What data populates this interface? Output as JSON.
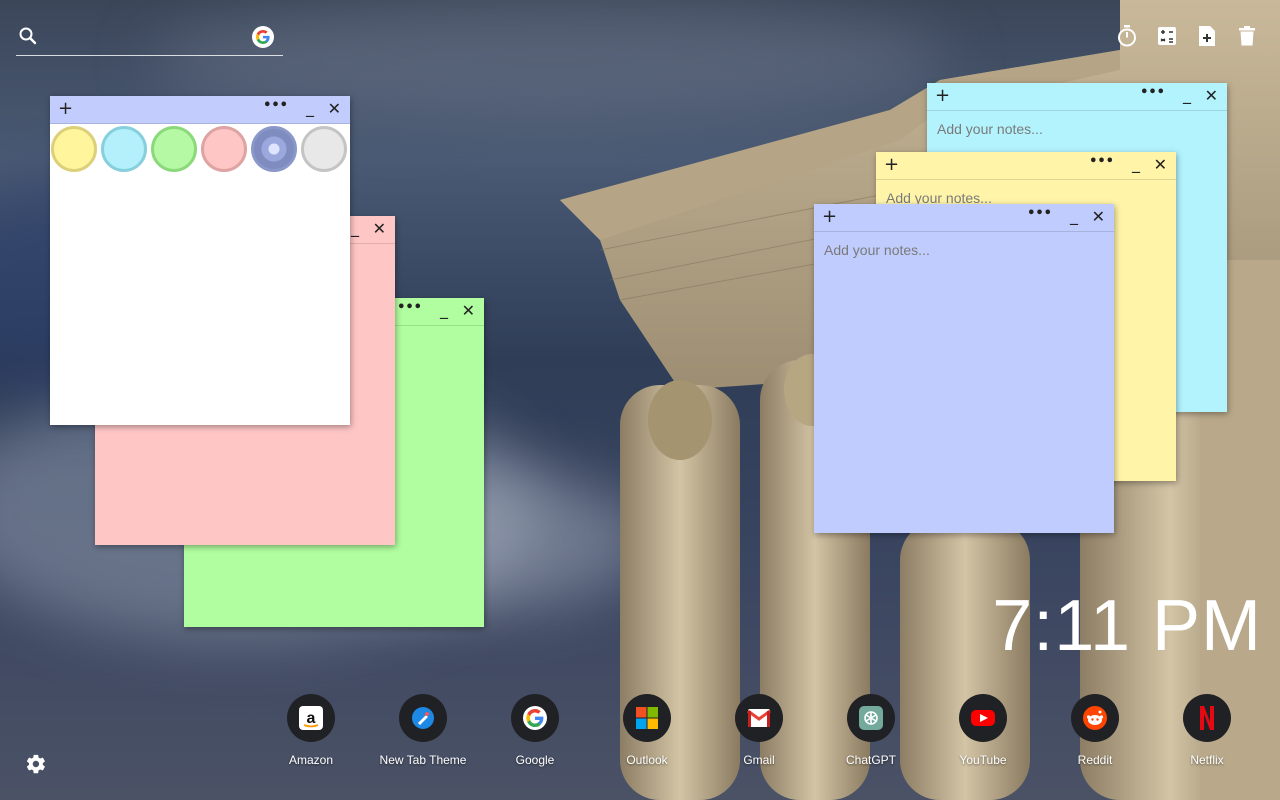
{
  "search": {
    "placeholder": "",
    "value": "",
    "icon": "search-icon",
    "engine_icon": "google-icon"
  },
  "tools": [
    {
      "name": "timer-icon"
    },
    {
      "name": "calculator-icon"
    },
    {
      "name": "add-note-icon"
    },
    {
      "name": "trash-icon"
    }
  ],
  "notes": {
    "controls": {
      "add": "+",
      "more": "•••",
      "minimize": "_",
      "close": "✕"
    },
    "placeholder": "Add your notes...",
    "colors": {
      "white": "#ffffff",
      "pink": "#ffc6c6",
      "green": "#b1fea0",
      "cyan": "#b3f3fd",
      "yellow": "#fff4a8",
      "lavender": "#bfccfd",
      "bar_white": "#c2ccfd",
      "bar_pink": "#ffc6c6",
      "bar_green": "#b1fea0",
      "bar_cyan": "#b3f3fd",
      "bar_yellow": "#fff4a8",
      "bar_lavender": "#bfccfd"
    },
    "swatches": [
      {
        "name": "yellow",
        "fill": "#fff59d",
        "ring": "#dcd07a"
      },
      {
        "name": "cyan",
        "fill": "#b3f0fb",
        "ring": "#86cfdc"
      },
      {
        "name": "green",
        "fill": "#b6f9a4",
        "ring": "#8bd97a"
      },
      {
        "name": "pink",
        "fill": "#ffc6c6",
        "ring": "#dea3a3"
      },
      {
        "name": "lavender",
        "fill": "#b6c3f7",
        "ring": "#8a97c9",
        "selected": true
      },
      {
        "name": "gray",
        "fill": "#e8e8e8",
        "ring": "#c4c4c4"
      }
    ]
  },
  "clock": {
    "time": "7:11 PM"
  },
  "shortcuts": [
    {
      "label": "Amazon",
      "icon": "amazon-icon"
    },
    {
      "label": "New Tab Theme",
      "icon": "new-tab-theme-icon"
    },
    {
      "label": "Google",
      "icon": "google-icon"
    },
    {
      "label": "Outlook",
      "icon": "microsoft-icon"
    },
    {
      "label": "Gmail",
      "icon": "gmail-icon"
    },
    {
      "label": "ChatGPT",
      "icon": "chatgpt-icon"
    },
    {
      "label": "YouTube",
      "icon": "youtube-icon"
    },
    {
      "label": "Reddit",
      "icon": "reddit-icon"
    },
    {
      "label": "Netflix",
      "icon": "netflix-icon"
    }
  ],
  "settings": {
    "icon": "gear-icon"
  }
}
